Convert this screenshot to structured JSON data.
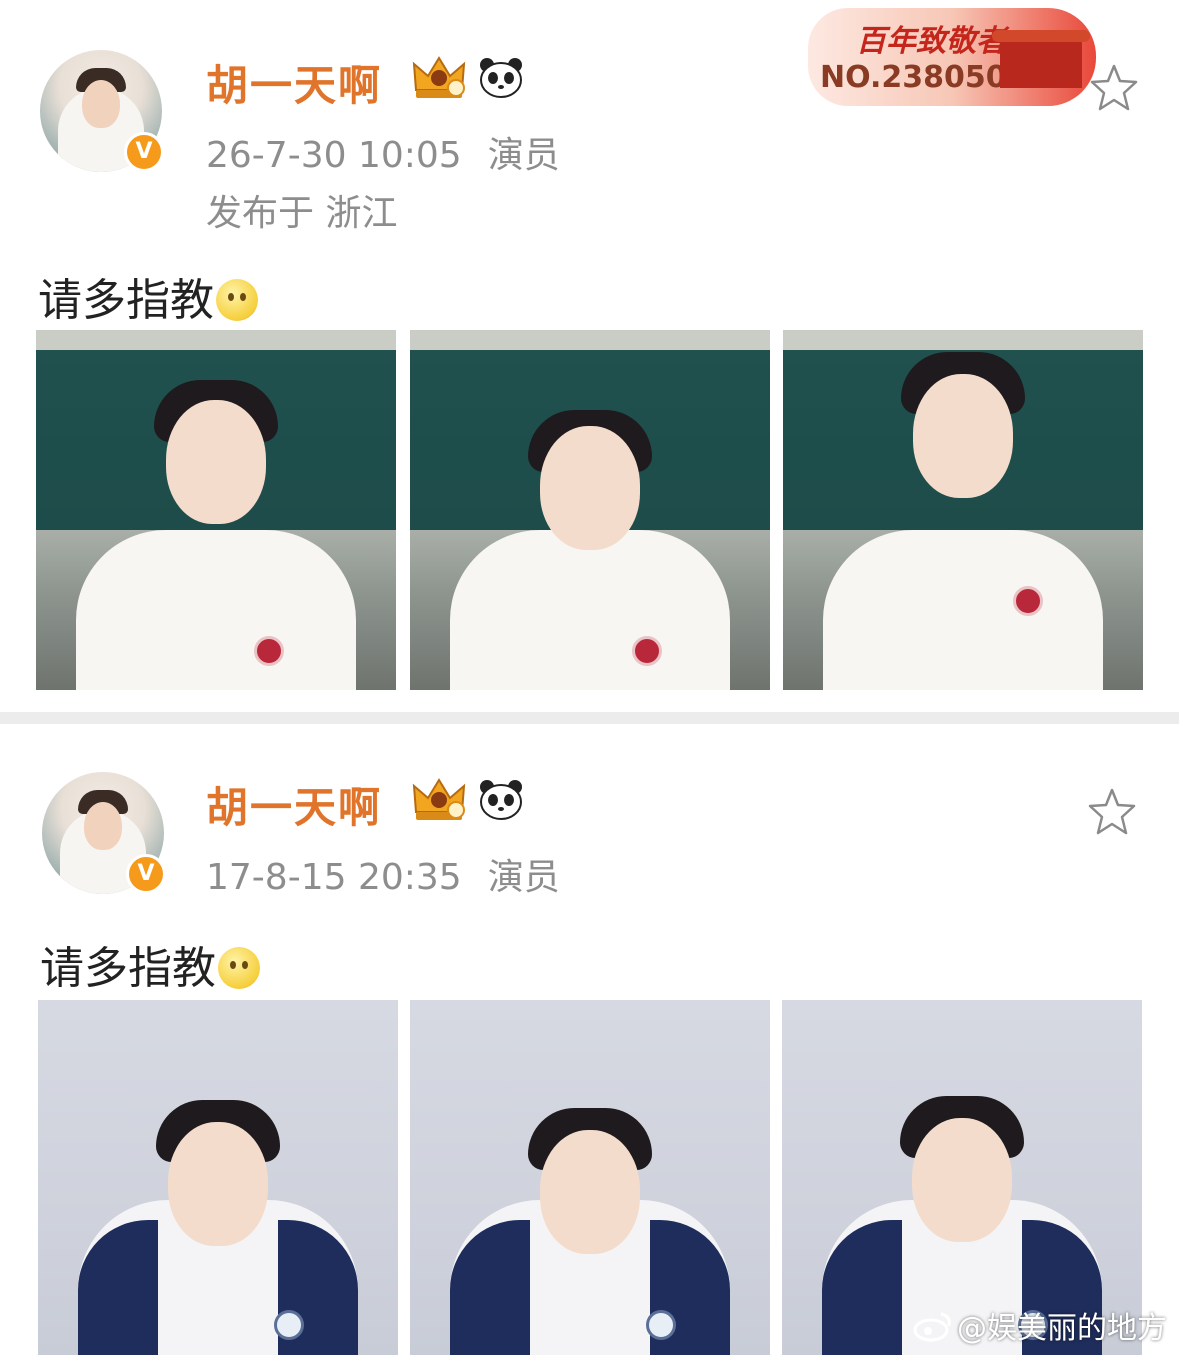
{
  "posts": [
    {
      "username": "胡一天啊",
      "time": "26-7-30 10:05",
      "role": "演员",
      "location": "发布于 浙江",
      "text": "请多指教",
      "badge": {
        "title": "百年致敬者",
        "number": "NO.2380504"
      }
    },
    {
      "username": "胡一天啊",
      "time": "17-8-15 20:35",
      "role": "演员",
      "text": "请多指教"
    }
  ],
  "watermark": "@娱美丽的地方",
  "colors": {
    "username": "#e0742a",
    "meta": "#8d8d8d",
    "verified": "#f59a1a",
    "divider": "#ececec"
  },
  "icons": [
    "verified-v-icon",
    "crown-level-icon",
    "panda-icon",
    "star-icon",
    "thinking-emoji-icon",
    "weibo-logo-icon"
  ]
}
